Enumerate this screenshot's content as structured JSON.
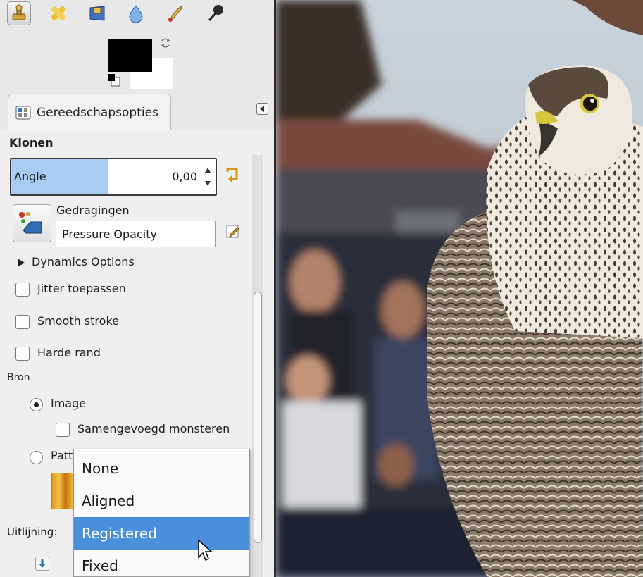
{
  "toolbox": {
    "tools": [
      "stamp-tool-icon",
      "heal-tool-icon",
      "perspective-clone-icon",
      "blur-tool-icon",
      "smudge-tool-icon",
      "dodge-burn-icon"
    ]
  },
  "dock": {
    "tab_label": "Gereedschapsopties"
  },
  "tool_options": {
    "title": "Klonen",
    "angle": {
      "label": "Angle",
      "value": "0,00"
    },
    "dynamics": {
      "label": "Gedragingen",
      "value": "Pressure Opacity"
    },
    "dynamics_options_label": "Dynamics Options",
    "checkboxes": [
      {
        "label": "Jitter toepassen",
        "checked": false
      },
      {
        "label": "Smooth stroke",
        "checked": false
      },
      {
        "label": "Harde rand",
        "checked": false
      }
    ],
    "source": {
      "label": "Bron",
      "image_label": "Image",
      "sample_merged_label": "Samengevoegd monsteren",
      "pattern_label_visible": "Patt"
    },
    "alignment_label": "Uitlijning:"
  },
  "alignment_dropdown": {
    "options": [
      "None",
      "Aligned",
      "Registered",
      "Fixed"
    ],
    "highlighted": "Registered"
  },
  "colors": {
    "foreground": "#000000",
    "background": "#ffffff",
    "highlight": "#4a8fdc",
    "angle_fill": "#a8ccf2"
  }
}
